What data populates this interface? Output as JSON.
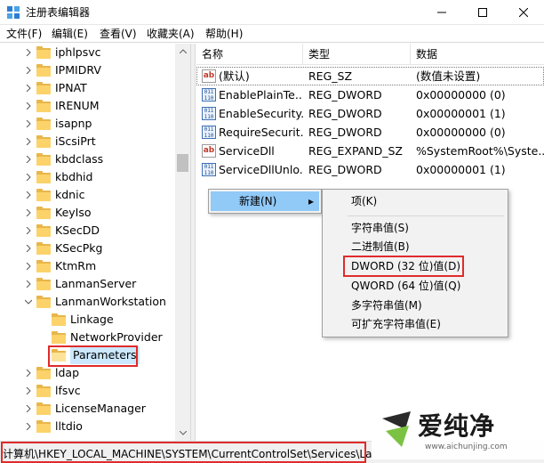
{
  "window": {
    "title": "注册表编辑器",
    "icon": "regedit-icon",
    "controls": [
      "minimize-icon",
      "maximize-icon",
      "close-icon"
    ]
  },
  "menubar": {
    "items": [
      "文件(F)",
      "编辑(E)",
      "查看(V)",
      "收藏夹(A)",
      "帮助(H)"
    ]
  },
  "tree": {
    "items": [
      {
        "label": "iphlpsvc"
      },
      {
        "label": "IPMIDRV"
      },
      {
        "label": "IPNAT"
      },
      {
        "label": "IRENUM"
      },
      {
        "label": "isapnp"
      },
      {
        "label": "iScsiPrt"
      },
      {
        "label": "kbdclass"
      },
      {
        "label": "kbdhid"
      },
      {
        "label": "kdnic"
      },
      {
        "label": "KeyIso"
      },
      {
        "label": "KSecDD"
      },
      {
        "label": "KSecPkg"
      },
      {
        "label": "KtmRm"
      },
      {
        "label": "LanmanServer"
      },
      {
        "label": "LanmanWorkstation"
      },
      {
        "label": "Linkage"
      },
      {
        "label": "NetworkProvider"
      },
      {
        "label": "Parameters"
      },
      {
        "label": "ldap"
      },
      {
        "label": "lfsvc"
      },
      {
        "label": "LicenseManager"
      },
      {
        "label": "lltdio"
      }
    ],
    "selected": "Parameters"
  },
  "list": {
    "columns": [
      "名称",
      "类型",
      "数据"
    ],
    "rows": [
      {
        "icon": "string-value-icon",
        "name": "(默认)",
        "type": "REG_SZ",
        "data": "(数值未设置)"
      },
      {
        "icon": "dword-value-icon",
        "name": "EnablePlainTe...",
        "type": "REG_DWORD",
        "data": "0x00000000 (0)"
      },
      {
        "icon": "dword-value-icon",
        "name": "EnableSecurity...",
        "type": "REG_DWORD",
        "data": "0x00000001 (1)"
      },
      {
        "icon": "dword-value-icon",
        "name": "RequireSecurit...",
        "type": "REG_DWORD",
        "data": "0x00000000 (0)"
      },
      {
        "icon": "string-value-icon",
        "name": "ServiceDll",
        "type": "REG_EXPAND_SZ",
        "data": "%SystemRoot%\\Syste..."
      },
      {
        "icon": "dword-value-icon",
        "name": "ServiceDllUnlo...",
        "type": "REG_DWORD",
        "data": "0x00000001 (1)"
      }
    ]
  },
  "context_menu": {
    "new_label": "新建(N)",
    "arrow": "▸"
  },
  "submenu": {
    "items": [
      "项(K)",
      "字符串值(S)",
      "二进制值(B)",
      "DWORD (32 位)值(D)",
      "QWORD (64 位)值(Q)",
      "多字符串值(M)",
      "可扩充字符串值(E)"
    ],
    "highlighted": "DWORD (32 位)值(D)"
  },
  "statusbar": {
    "path": "计算机\\HKEY_LOCAL_MACHINE\\SYSTEM\\CurrentControlSet\\Services\\La"
  },
  "watermark": {
    "text": "爱纯净",
    "url": "www.aichunjing.com"
  },
  "colors": {
    "selection": "#cce8ff",
    "menu_highlight": "#91c9f7",
    "red_box": "#e02b2b",
    "folder": "#fcd36a"
  }
}
